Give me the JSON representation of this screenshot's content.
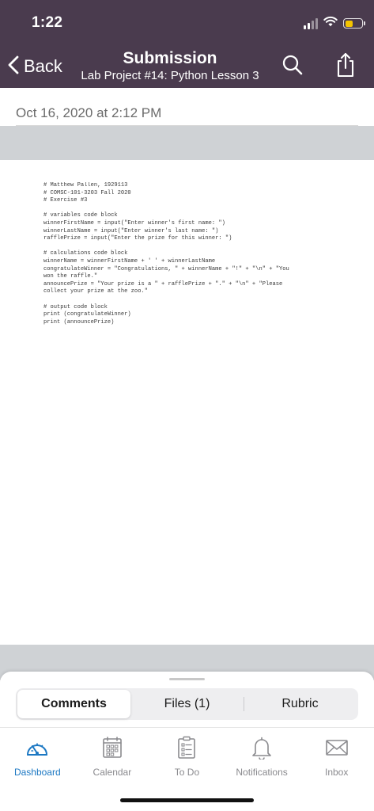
{
  "status_bar": {
    "time": "1:22",
    "battery_percent": 45,
    "battery_color": "#f5c400"
  },
  "nav": {
    "back_label": "Back",
    "title": "Submission",
    "subtitle": "Lab Project #14: Python Lesson 3",
    "actions": [
      "search-icon",
      "share-icon"
    ]
  },
  "submission": {
    "date": "Oct 16, 2020 at 2:12 PM"
  },
  "document": {
    "code_lines": [
      "# Matthew Pallen, 1929113",
      "# COMSC-101-3203 Fall 2020",
      "# Exercise #3",
      "",
      "# variables code block",
      "winnerFirstName = input(\"Enter winner's first name: \")",
      "winnerLastName = input(\"Enter winner's last name: \")",
      "rafflePrize = input(\"Enter the prize for this winner: \")",
      "",
      "# calculations code block",
      "winnerName = winnerFirstName + ' ' + winnerLastName",
      "congratulateWinner = \"Congratulations, \" + winnerName + \"!\" + \"\\n\" + \"You",
      "won the raffle.\"",
      "announcePrize = \"Your prize is a \" + rafflePrize + \".\" + \"\\n\" + \"Please",
      "collect your prize at the zoo.\"",
      "",
      "# output code block",
      "print (congratulateWinner)",
      "print (announcePrize)"
    ]
  },
  "sheet": {
    "tabs": [
      {
        "label": "Comments",
        "active": true
      },
      {
        "label": "Files (1)",
        "active": false
      },
      {
        "label": "Rubric",
        "active": false
      }
    ]
  },
  "tabbar": {
    "accent": "#1c78c3",
    "items": [
      {
        "label": "Dashboard",
        "icon": "dashboard-icon",
        "active": true
      },
      {
        "label": "Calendar",
        "icon": "calendar-icon",
        "active": false
      },
      {
        "label": "To Do",
        "icon": "todo-icon",
        "active": false
      },
      {
        "label": "Notifications",
        "icon": "bell-icon",
        "active": false
      },
      {
        "label": "Inbox",
        "icon": "inbox-icon",
        "active": false
      }
    ]
  },
  "colors": {
    "header_bg": "#4a3b4e",
    "viewer_bg": "#cfd2d5"
  }
}
